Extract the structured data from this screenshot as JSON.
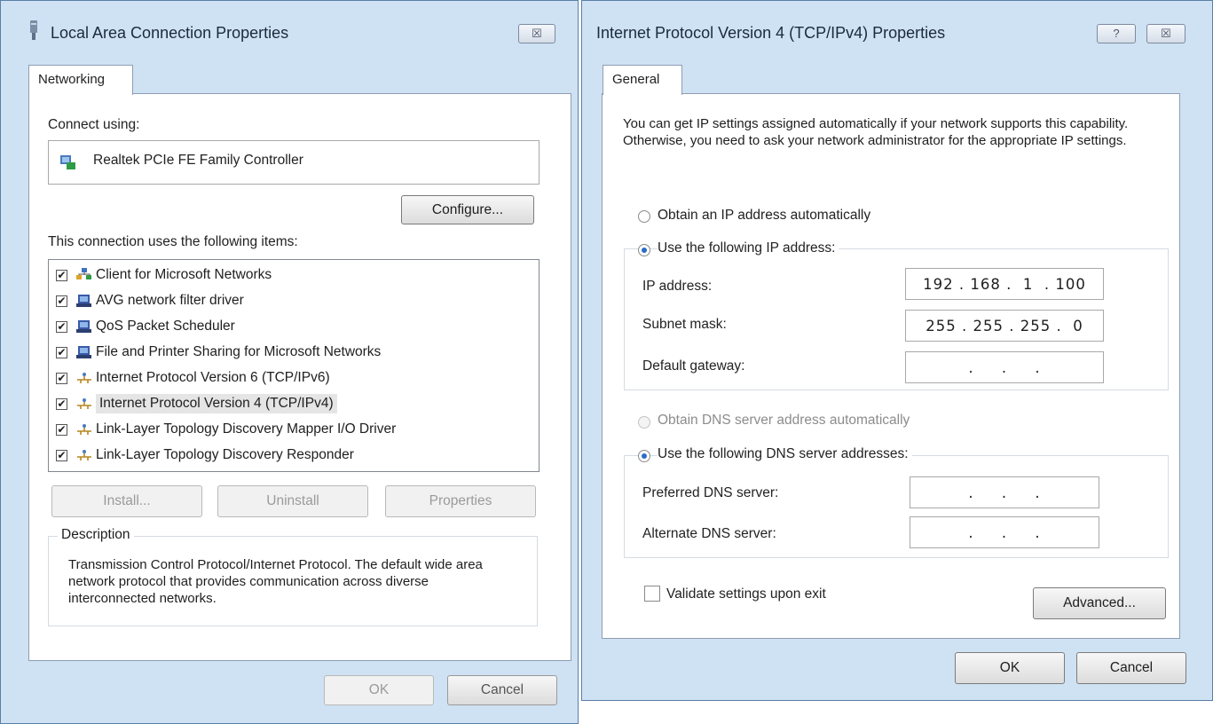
{
  "left_dialog": {
    "title": "Local Area Connection Properties",
    "close_glyph": "☒",
    "tab": "Networking",
    "connect_using_label": "Connect using:",
    "adapter_name": "Realtek PCIe FE Family Controller",
    "configure_label": "Configure...",
    "items_label": "This connection uses the following items:",
    "items": [
      {
        "label": "Client for Microsoft Networks",
        "checked": true,
        "icon": "network-client-icon"
      },
      {
        "label": "AVG network filter driver",
        "checked": true,
        "icon": "network-service-icon"
      },
      {
        "label": "QoS Packet Scheduler",
        "checked": true,
        "icon": "network-service-icon"
      },
      {
        "label": "File and Printer Sharing for Microsoft Networks",
        "checked": true,
        "icon": "network-service-icon"
      },
      {
        "label": "Internet Protocol Version 6 (TCP/IPv6)",
        "checked": true,
        "icon": "protocol-icon"
      },
      {
        "label": "Internet Protocol Version 4 (TCP/IPv4)",
        "checked": true,
        "icon": "protocol-icon",
        "selected": true
      },
      {
        "label": "Link-Layer Topology Discovery Mapper I/O Driver",
        "checked": true,
        "icon": "protocol-icon"
      },
      {
        "label": "Link-Layer Topology Discovery Responder",
        "checked": true,
        "icon": "protocol-icon"
      }
    ],
    "install_label": "Install...",
    "uninstall_label": "Uninstall",
    "properties_label": "Properties",
    "description_title": "Description",
    "description_text": "Transmission Control Protocol/Internet Protocol. The default wide area network protocol that provides communication across diverse interconnected networks.",
    "ok_label": "OK",
    "cancel_label": "Cancel"
  },
  "right_dialog": {
    "title": "Internet Protocol Version 4 (TCP/IPv4) Properties",
    "help_glyph": "?",
    "close_glyph": "☒",
    "tab": "General",
    "intro_text": "You can get IP settings assigned automatically if your network supports this capability. Otherwise, you need to ask your network administrator for the appropriate IP settings.",
    "obtain_ip_auto": "Obtain an IP address automatically",
    "use_following_ip": "Use the following IP address:",
    "ip_address_label": "IP address:",
    "ip_address_value": "192 . 168 .  1  . 100",
    "subnet_mask_label": "Subnet mask:",
    "subnet_mask_value": "255 . 255 . 255 .  0",
    "default_gateway_label": "Default gateway:",
    "default_gateway_value": "  .     .     .  ",
    "obtain_dns_auto": "Obtain DNS server address automatically",
    "use_following_dns": "Use the following DNS server addresses:",
    "preferred_dns_label": "Preferred DNS server:",
    "preferred_dns_value": "  .     .     .  ",
    "alternate_dns_label": "Alternate DNS server:",
    "alternate_dns_value": "  .     .     .  ",
    "validate_label": "Validate settings upon exit",
    "advanced_label": "Advanced...",
    "ok_label": "OK",
    "cancel_label": "Cancel"
  },
  "colors": {
    "window_frame": "#cfe2f3",
    "client_bg": "#f0f0f0",
    "radio_selected": "#2a6dc4"
  }
}
